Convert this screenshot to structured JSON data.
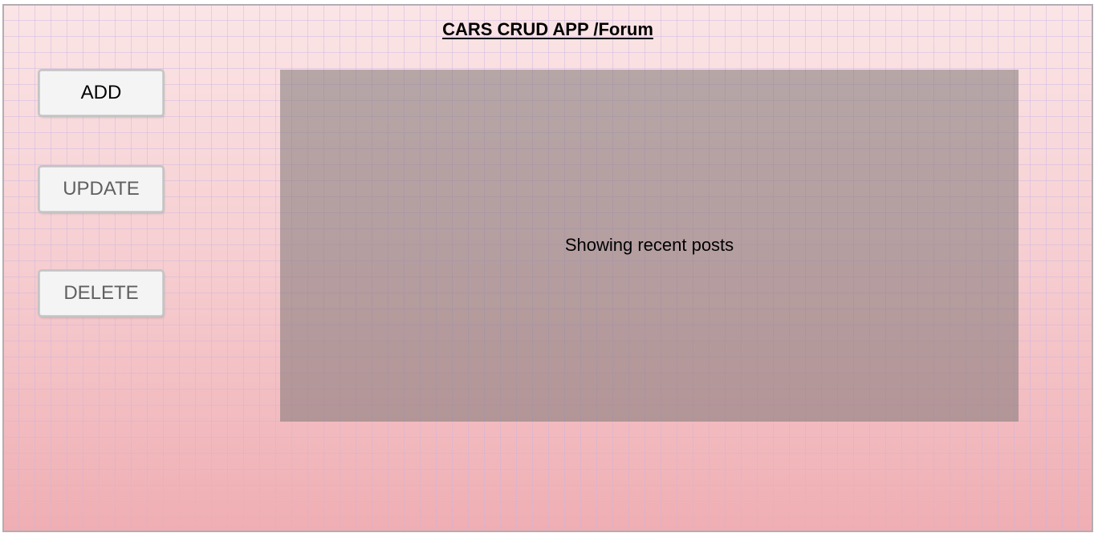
{
  "header": {
    "title": "CARS CRUD APP /Forum"
  },
  "actions": {
    "add_label": "ADD",
    "update_label": "UPDATE",
    "delete_label": "DELETE"
  },
  "main": {
    "panel_text": "Showing recent posts"
  },
  "colors": {
    "background_top": "#fbe5e6",
    "background_bottom": "#efaeb3",
    "grid_line": "#c8b4e1",
    "panel_fill": "#a48a8c",
    "button_fill": "#f4f4f4",
    "button_text_enabled": "#000000",
    "button_text_secondary": "#606060"
  }
}
